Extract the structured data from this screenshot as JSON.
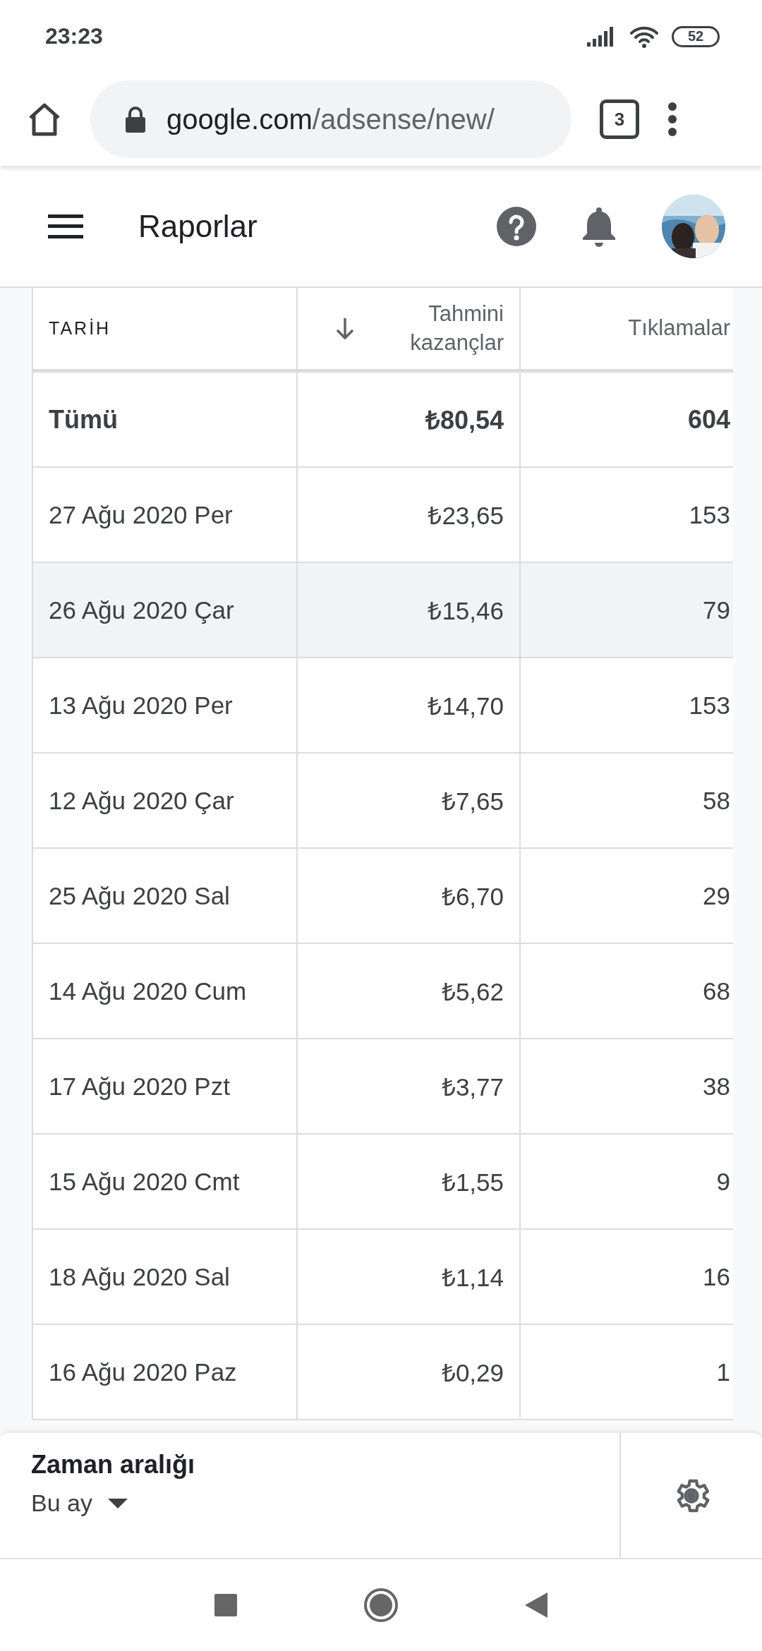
{
  "status_bar": {
    "time": "23:23",
    "battery": "52"
  },
  "browser": {
    "url_host": "google.com",
    "url_path": "/adsense/new/",
    "tab_count": "3"
  },
  "app_bar": {
    "title": "Raporlar"
  },
  "table": {
    "columns": [
      {
        "label": "TARİH",
        "sorted": false
      },
      {
        "label": "Tahmini kazançlar",
        "sorted": true
      },
      {
        "label": "Tıklamalar",
        "sorted": false
      }
    ],
    "total": [
      "Tümü",
      "₺80,54",
      "604"
    ],
    "rows": [
      {
        "cells": [
          "27 Ağu 2020 Per",
          "₺23,65",
          "153"
        ],
        "selected": false
      },
      {
        "cells": [
          "26 Ağu 2020 Çar",
          "₺15,46",
          "79"
        ],
        "selected": true
      },
      {
        "cells": [
          "13 Ağu 2020 Per",
          "₺14,70",
          "153"
        ],
        "selected": false
      },
      {
        "cells": [
          "12 Ağu 2020 Çar",
          "₺7,65",
          "58"
        ],
        "selected": false
      },
      {
        "cells": [
          "25 Ağu 2020 Sal",
          "₺6,70",
          "29"
        ],
        "selected": false
      },
      {
        "cells": [
          "14 Ağu 2020 Cum",
          "₺5,62",
          "68"
        ],
        "selected": false
      },
      {
        "cells": [
          "17 Ağu 2020 Pzt",
          "₺3,77",
          "38"
        ],
        "selected": false
      },
      {
        "cells": [
          "15 Ağu 2020 Cmt",
          "₺1,55",
          "9"
        ],
        "selected": false
      },
      {
        "cells": [
          "18 Ağu 2020 Sal",
          "₺1,14",
          "16"
        ],
        "selected": false
      },
      {
        "cells": [
          "16 Ağu 2020 Paz",
          "₺0,29",
          "1"
        ],
        "selected": false
      }
    ]
  },
  "bottom_panel": {
    "title": "Zaman aralığı",
    "range": "Bu ay"
  }
}
